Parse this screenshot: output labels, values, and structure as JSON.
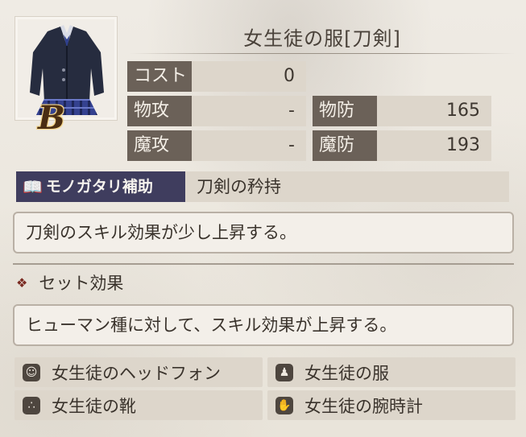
{
  "item": {
    "title": "女生徒の服[刀剣]",
    "rank": "B",
    "icon": "school-uniform-icon"
  },
  "stats": {
    "cost": {
      "label": "コスト",
      "value": "0"
    },
    "phys_atk": {
      "label": "物攻",
      "value": "-"
    },
    "phys_def": {
      "label": "物防",
      "value": "165"
    },
    "mag_atk": {
      "label": "魔攻",
      "value": "-"
    },
    "mag_def": {
      "label": "魔防",
      "value": "193"
    }
  },
  "story": {
    "tag_label": "モノガタリ補助",
    "tag_icon": "book-icon",
    "name": "刀剣の矜持",
    "description": "刀剣のスキル効果が少し上昇する。"
  },
  "set": {
    "header": "セット効果",
    "header_icon": "ornament-diamond-icon",
    "description": "ヒューマン種に対して、スキル効果が上昇する。",
    "pieces": [
      {
        "label": "女生徒のヘッドフォン",
        "icon": "head-icon"
      },
      {
        "label": "女生徒の服",
        "icon": "body-icon"
      },
      {
        "label": "女生徒の靴",
        "icon": "foot-icon"
      },
      {
        "label": "女生徒の腕時計",
        "icon": "hand-icon"
      }
    ]
  },
  "colors": {
    "label_bg": "#6b6158",
    "value_bg": "#ddd6cb",
    "story_tag_bg": "#3f3d5e",
    "panel_border": "#b9b0a5"
  }
}
